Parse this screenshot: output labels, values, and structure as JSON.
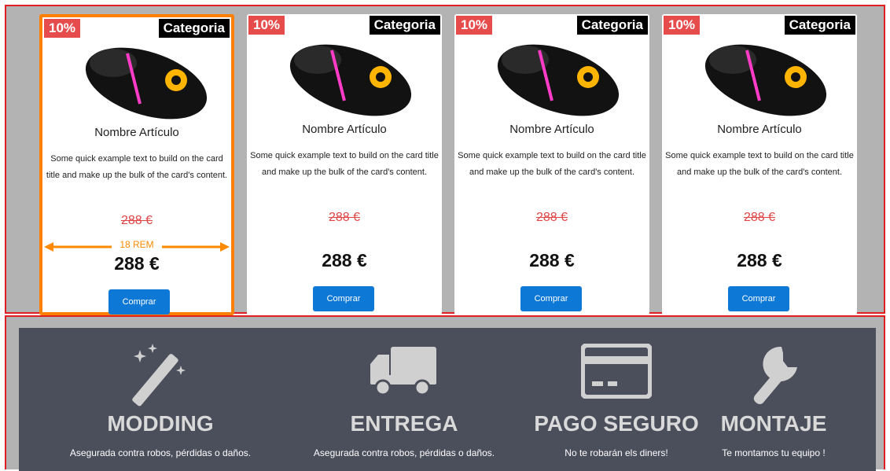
{
  "products": {
    "cards": [
      {
        "discount": "10%",
        "category": "Categoria",
        "title": "Nombre Artículo",
        "description": "Some quick example text to build on the card title and make up the bulk of the card's content.",
        "old_price": "288 €",
        "price": "288 €",
        "button": "Comprar",
        "annotation": "18 REM"
      },
      {
        "discount": "10%",
        "category": "Categoria",
        "title": "Nombre Artículo",
        "description": "Some quick example text to build on the card title and make up the bulk of the card's content.",
        "old_price": "288 €",
        "price": "288 €",
        "button": "Comprar"
      },
      {
        "discount": "10%",
        "category": "Categoria",
        "title": "Nombre Artículo",
        "description": "Some quick example text to build on the card title and make up the bulk of the card's content.",
        "old_price": "288 €",
        "price": "288 €",
        "button": "Comprar"
      },
      {
        "discount": "10%",
        "category": "Categoria",
        "title": "Nombre Artículo",
        "description": "Some quick example text to build on the card title and make up the bulk of the card's content.",
        "old_price": "288 €",
        "price": "288 €",
        "button": "Comprar"
      }
    ]
  },
  "services": [
    {
      "icon": "magic-wand-icon",
      "title": "MODDING",
      "desc": "Asegurada contra robos, pérdidas o daños."
    },
    {
      "icon": "truck-icon",
      "title": "ENTREGA",
      "desc": "Asegurada contra robos, pérdidas o daños."
    },
    {
      "icon": "credit-card-icon",
      "title": "PAGO SEGURO",
      "desc": "No te robarán els diners!"
    },
    {
      "icon": "wrench-icon",
      "title": "MONTAJE",
      "desc": "Te montamos tu equipo !"
    }
  ],
  "colors": {
    "discount_bg": "#e74c4c",
    "category_bg": "#000000",
    "button_bg": "#0d78d6",
    "old_price": "#e04545",
    "highlight_border": "#ff7f00",
    "section_border": "#e02020",
    "service_bg": "#4b4e5b",
    "page_bg": "#b3b3b3"
  }
}
